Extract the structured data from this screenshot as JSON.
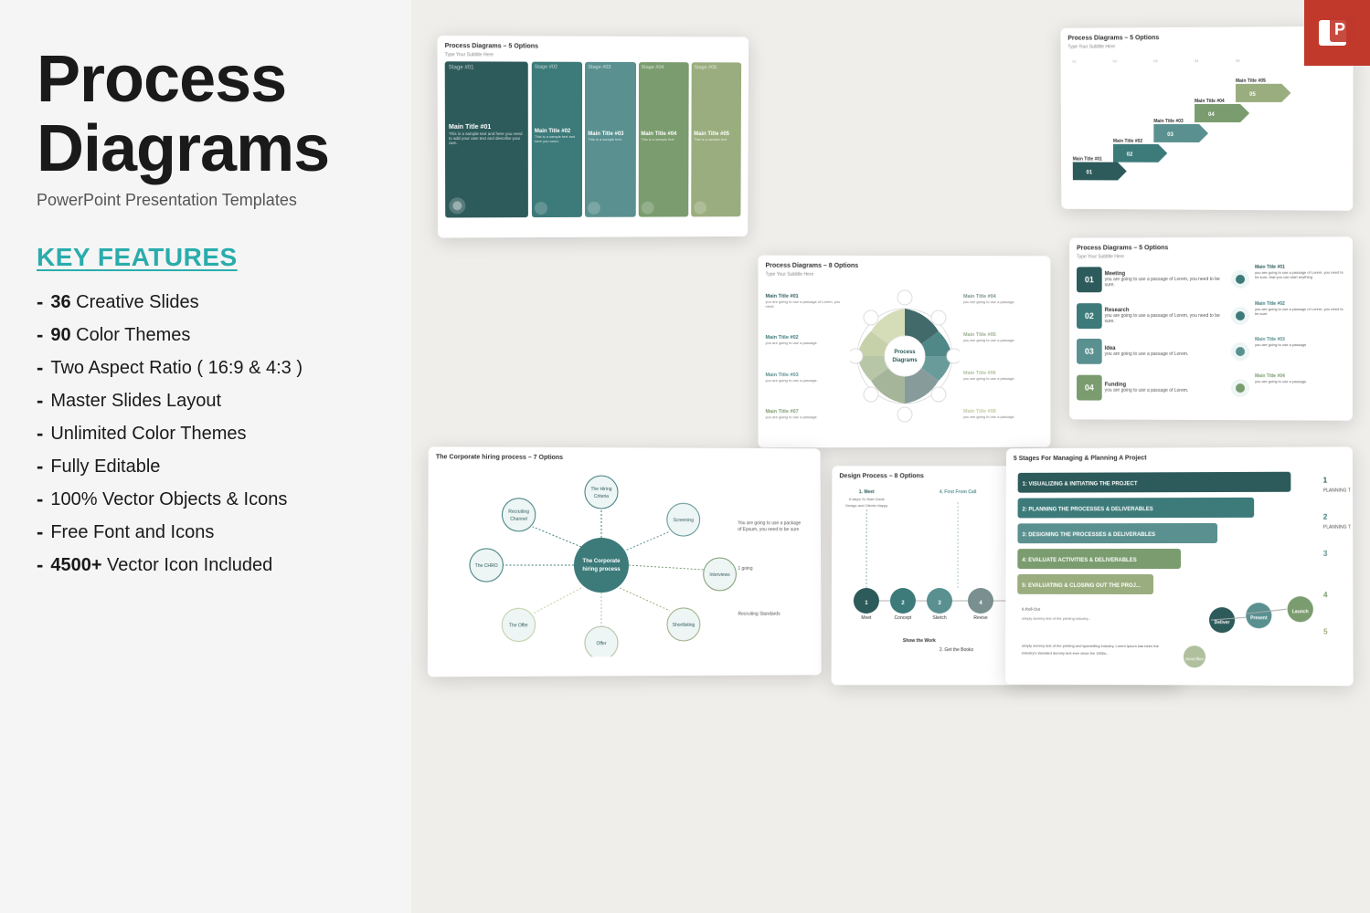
{
  "header": {
    "main_title": "Process Diagrams",
    "subtitle": "PowerPoint Presentation Templates",
    "ppt_icon_label": "P"
  },
  "features": {
    "section_label": "KEY FEATURES",
    "items": [
      {
        "dash": "-",
        "bold": "36",
        "text": " Creative Slides"
      },
      {
        "dash": "-",
        "bold": "90",
        "text": " Color Themes"
      },
      {
        "dash": "-",
        "bold": "",
        "text": "Two Aspect Ratio ( 16:9 & 4:3 )"
      },
      {
        "dash": "-",
        "bold": "",
        "text": "Master Slides Layout"
      },
      {
        "dash": "-",
        "bold": "",
        "text": "Unlimited Color Themes"
      },
      {
        "dash": "-",
        "bold": "",
        "text": "Fully Editable"
      },
      {
        "dash": "-",
        "bold": "",
        "text": "100% Vector Objects & Icons"
      },
      {
        "dash": "-",
        "bold": "",
        "text": "Free Font and Icons"
      },
      {
        "dash": "-",
        "bold": "4500+",
        "text": " Vector Icon Included"
      }
    ]
  },
  "slides": {
    "colors": {
      "teal_dark": "#2d5a5a",
      "teal_mid": "#3d7a7a",
      "teal_light": "#6aadad",
      "sage": "#7a8c5e",
      "sage_light": "#a8b87a",
      "olive": "#8a9c6e",
      "warm_gray": "#c8c0b0",
      "light_bg": "#f5f5f0"
    },
    "slide1": {
      "title": "Process Diagrams – 5 Options",
      "subtitle": "Type Your Subtitle Here"
    },
    "slide2": {
      "title": "Process Diagrams – 5 Options",
      "subtitle": "Type Your Subtitle Here"
    },
    "slide3": {
      "title": "Process Diagrams – 8 Options",
      "subtitle": "Type Your Subtitle Here"
    },
    "slide4": {
      "title": "The Corporate hiring process – 7 Options",
      "subtitle": ""
    },
    "slide5": {
      "title": "Design Process – 8 Options",
      "subtitle": ""
    },
    "slide6": {
      "title": "5 Stages For Managing & Planning A Project",
      "subtitle": ""
    }
  }
}
